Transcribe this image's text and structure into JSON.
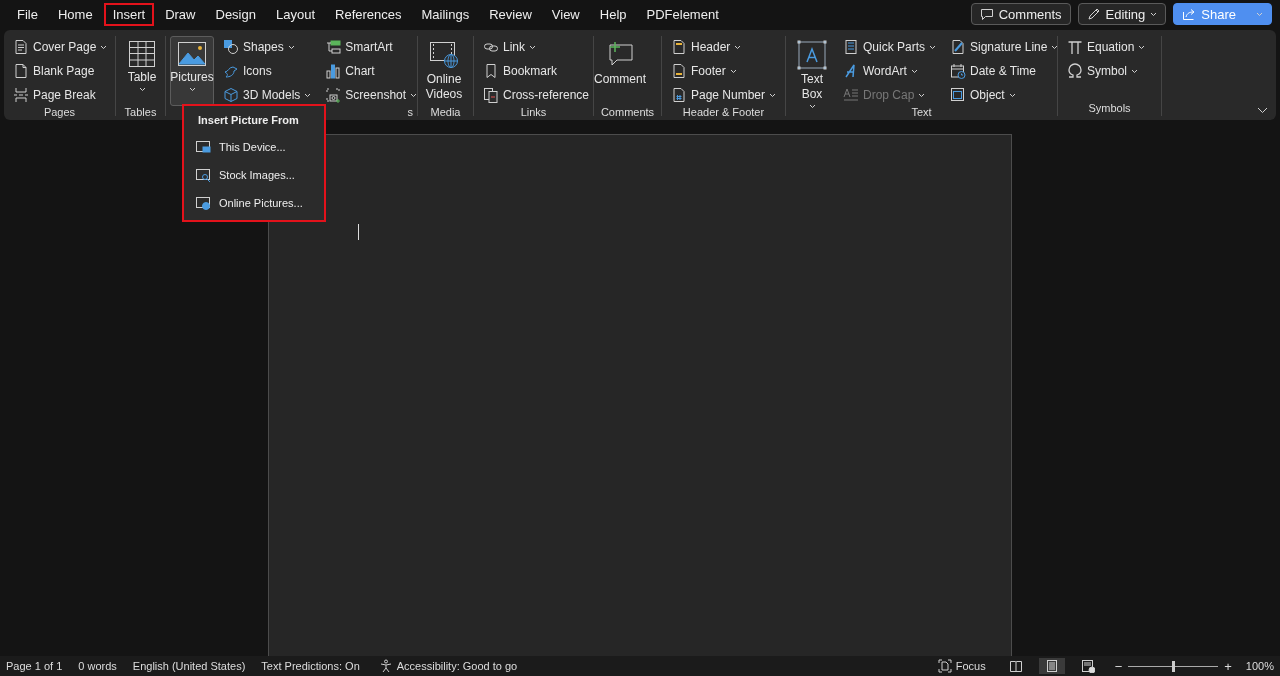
{
  "menu_bar": {
    "tabs": [
      {
        "label": "File",
        "selected": false
      },
      {
        "label": "Home",
        "selected": false
      },
      {
        "label": "Insert",
        "selected": true
      },
      {
        "label": "Draw",
        "selected": false
      },
      {
        "label": "Design",
        "selected": false
      },
      {
        "label": "Layout",
        "selected": false
      },
      {
        "label": "References",
        "selected": false
      },
      {
        "label": "Mailings",
        "selected": false
      },
      {
        "label": "Review",
        "selected": false
      },
      {
        "label": "View",
        "selected": false
      },
      {
        "label": "Help",
        "selected": false
      },
      {
        "label": "PDFelement",
        "selected": false
      }
    ],
    "comments_button": "Comments",
    "editing_button": "Editing",
    "share_button": "Share"
  },
  "ribbon": {
    "groups": [
      {
        "label": "Pages",
        "columns": [
          [
            {
              "label": "Cover Page",
              "kind": "small",
              "dropdown": true,
              "disabled": false,
              "pressed": false
            },
            {
              "label": "Blank Page",
              "kind": "small",
              "dropdown": false,
              "disabled": false,
              "pressed": false
            },
            {
              "label": "Page Break",
              "kind": "small",
              "dropdown": false,
              "disabled": false,
              "pressed": false
            }
          ]
        ]
      },
      {
        "label": "Tables",
        "columns": [
          [
            {
              "label": "Table",
              "kind": "large",
              "dropdown": true,
              "disabled": false,
              "pressed": false
            }
          ]
        ]
      },
      {
        "label": "s",
        "columns": [
          [
            {
              "label": "Pictures",
              "kind": "large",
              "dropdown": true,
              "disabled": false,
              "pressed": true
            }
          ],
          [
            {
              "label": "Shapes",
              "kind": "small",
              "dropdown": true,
              "disabled": false,
              "pressed": false
            },
            {
              "label": "Icons",
              "kind": "small",
              "dropdown": false,
              "disabled": false,
              "pressed": false
            },
            {
              "label": "3D Models",
              "kind": "small",
              "dropdown": true,
              "disabled": false,
              "pressed": false
            }
          ],
          [
            {
              "label": "SmartArt",
              "kind": "small",
              "dropdown": false,
              "disabled": false,
              "pressed": false
            },
            {
              "label": "Chart",
              "kind": "small",
              "dropdown": false,
              "disabled": false,
              "pressed": false
            },
            {
              "label": "Screenshot",
              "kind": "small",
              "dropdown": true,
              "disabled": false,
              "pressed": false
            }
          ]
        ]
      },
      {
        "label": "Media",
        "columns": [
          [
            {
              "label": "Online Videos",
              "kind": "large",
              "dropdown": false,
              "disabled": false,
              "pressed": false
            }
          ]
        ]
      },
      {
        "label": "Links",
        "columns": [
          [
            {
              "label": "Link",
              "kind": "small",
              "dropdown": true,
              "disabled": false,
              "pressed": false
            },
            {
              "label": "Bookmark",
              "kind": "small",
              "dropdown": false,
              "disabled": false,
              "pressed": false
            },
            {
              "label": "Cross-reference",
              "kind": "small",
              "dropdown": false,
              "disabled": false,
              "pressed": false
            }
          ]
        ]
      },
      {
        "label": "Comments",
        "columns": [
          [
            {
              "label": "Comment",
              "kind": "large",
              "dropdown": false,
              "disabled": false,
              "pressed": false
            }
          ]
        ]
      },
      {
        "label": "Header & Footer",
        "columns": [
          [
            {
              "label": "Header",
              "kind": "small",
              "dropdown": true,
              "disabled": false,
              "pressed": false
            },
            {
              "label": "Footer",
              "kind": "small",
              "dropdown": true,
              "disabled": false,
              "pressed": false
            },
            {
              "label": "Page Number",
              "kind": "small",
              "dropdown": true,
              "disabled": false,
              "pressed": false
            }
          ]
        ]
      },
      {
        "label": "Text",
        "columns": [
          [
            {
              "label": "Text Box",
              "kind": "large",
              "dropdown": true,
              "disabled": false,
              "pressed": false
            }
          ],
          [
            {
              "label": "Quick Parts",
              "kind": "small",
              "dropdown": true,
              "disabled": false,
              "pressed": false
            },
            {
              "label": "WordArt",
              "kind": "small",
              "dropdown": true,
              "disabled": false,
              "pressed": false
            },
            {
              "label": "Drop Cap",
              "kind": "small",
              "dropdown": true,
              "disabled": true,
              "pressed": false
            }
          ],
          [
            {
              "label": "Signature Line",
              "kind": "small",
              "dropdown": true,
              "disabled": false,
              "pressed": false
            },
            {
              "label": "Date & Time",
              "kind": "small",
              "dropdown": false,
              "disabled": false,
              "pressed": false
            },
            {
              "label": "Object",
              "kind": "small",
              "dropdown": true,
              "disabled": false,
              "pressed": false
            }
          ]
        ]
      },
      {
        "label": "Symbols",
        "columns": [
          [
            {
              "label": "Equation",
              "kind": "small",
              "dropdown": true,
              "disabled": false,
              "pressed": false
            },
            {
              "label": "Symbol",
              "kind": "small",
              "dropdown": true,
              "disabled": false,
              "pressed": false
            }
          ]
        ]
      }
    ]
  },
  "picture_menu": {
    "title": "Insert Picture From",
    "items": [
      "This Device...",
      "Stock Images...",
      "Online Pictures..."
    ]
  },
  "status_bar": {
    "items": [
      "Page 1 of 1",
      "0 words",
      "English (United States)",
      "Text Predictions: On"
    ],
    "accessibility": "Accessibility: Good to go",
    "focus": "Focus",
    "views": [
      {
        "selected": false
      },
      {
        "selected": true
      },
      {
        "selected": false
      }
    ],
    "zoom_out": "−",
    "zoom_in": "+",
    "zoom": {
      "level": 0.5
    },
    "zoom_percent": "100%"
  }
}
